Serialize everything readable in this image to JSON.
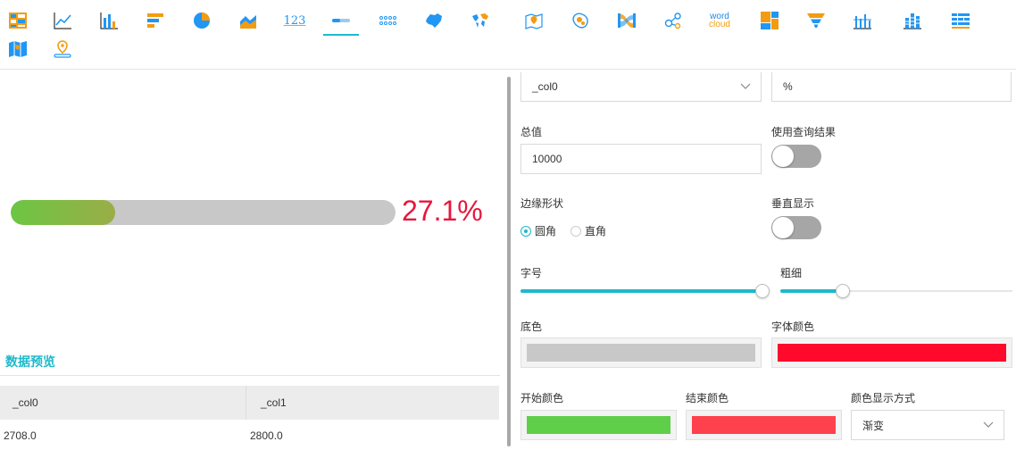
{
  "toolbar": {
    "icons": [
      {
        "name": "table-icon",
        "active": false
      },
      {
        "name": "line-chart-icon",
        "active": false
      },
      {
        "name": "bar-chart-icon",
        "active": false
      },
      {
        "name": "horizontal-bar-icon",
        "active": false
      },
      {
        "name": "pie-chart-icon",
        "active": false
      },
      {
        "name": "area-chart-icon",
        "active": false
      },
      {
        "name": "number-kpi-icon",
        "active": false
      },
      {
        "name": "progress-bar-icon",
        "active": true
      },
      {
        "name": "dot-matrix-icon",
        "active": false
      },
      {
        "name": "china-map-icon",
        "active": false
      },
      {
        "name": "world-map-icon",
        "active": false
      },
      {
        "name": "location-map-icon",
        "active": false
      },
      {
        "name": "bubble-map-icon",
        "active": false
      },
      {
        "name": "sankey-icon",
        "active": false
      },
      {
        "name": "network-graph-icon",
        "active": false
      },
      {
        "name": "word-cloud-icon",
        "active": false
      },
      {
        "name": "treemap-icon",
        "active": false
      },
      {
        "name": "funnel-icon",
        "active": false
      },
      {
        "name": "histogram-icon",
        "active": false
      },
      {
        "name": "stacked-bar-icon",
        "active": false
      },
      {
        "name": "heatmap-table-icon",
        "active": false
      },
      {
        "name": "region-map-icon",
        "active": false
      },
      {
        "name": "pin-map-icon",
        "active": false
      }
    ],
    "number_text": "123",
    "word_text": "word",
    "cloud_text": "cloud"
  },
  "preview": {
    "percent_value": 0.271,
    "percent_text": "27.1%",
    "track_color": "#c8c8c8",
    "start_color": "#6cc644",
    "end_color": "#9aad47",
    "text_color": "#e8163c"
  },
  "data_preview": {
    "title": "数据预览",
    "columns": [
      "_col0",
      "_col1"
    ],
    "rows": [
      [
        "2708.0",
        "2800.0"
      ]
    ]
  },
  "settings": {
    "field_select_value": "_col0",
    "suffix_value": "%",
    "total_label": "总值",
    "total_value": "10000",
    "use_query_label": "使用查询结果",
    "use_query_on": false,
    "edge_shape_label": "边缘形状",
    "edge_options": [
      "圆角",
      "直角"
    ],
    "edge_selected": 0,
    "vertical_label": "垂直显示",
    "vertical_on": false,
    "font_size_label": "字号",
    "font_size_level": 1.0,
    "thickness_label": "粗细",
    "thickness_level": 0.27,
    "base_color_label": "底色",
    "base_color": "#c8c8c8",
    "font_color_label": "字体颜色",
    "font_color": "#ff0a2c",
    "start_color_label": "开始颜色",
    "start_color": "#5fcf49",
    "end_color_label": "结束颜色",
    "end_color": "#ff414d",
    "color_mode_label": "颜色显示方式",
    "color_mode_value": "渐变"
  }
}
